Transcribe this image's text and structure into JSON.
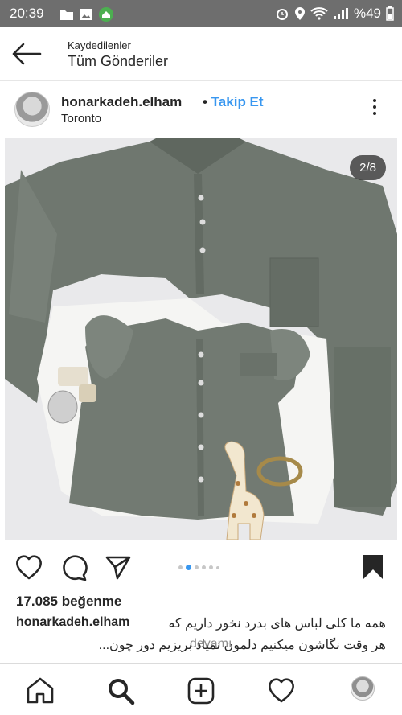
{
  "status": {
    "time": "20:39",
    "battery": "%49"
  },
  "appbar": {
    "subtitle": "Kaydedilenler",
    "title": "Tüm Gönderiler"
  },
  "post": {
    "username": "honarkadeh.elham",
    "separator": "•",
    "follow_label": "Takip Et",
    "location": "Toronto",
    "image_counter": "2/8",
    "likes": "17.085 beğenme",
    "caption_user": "honarkadeh.elham",
    "caption_line1": "همه ما کلی لباس های بدرد نخور داریم که",
    "caption_line2": "هر وقت نگاشون میکنیم دلمون نمیاد بریزیم دور چون...",
    "caption_more": "devamı"
  },
  "carousel": {
    "count": 6,
    "active_index": 1
  },
  "colors": {
    "accent": "#3897f0",
    "statusbar": "#6e6e6e",
    "shirt": "#6f776f"
  },
  "icons": [
    "back-arrow-icon",
    "heart-icon",
    "comment-icon",
    "share-icon",
    "bookmark-icon",
    "home-icon",
    "search-icon",
    "add-icon",
    "activity-heart-icon",
    "profile-avatar-icon"
  ]
}
